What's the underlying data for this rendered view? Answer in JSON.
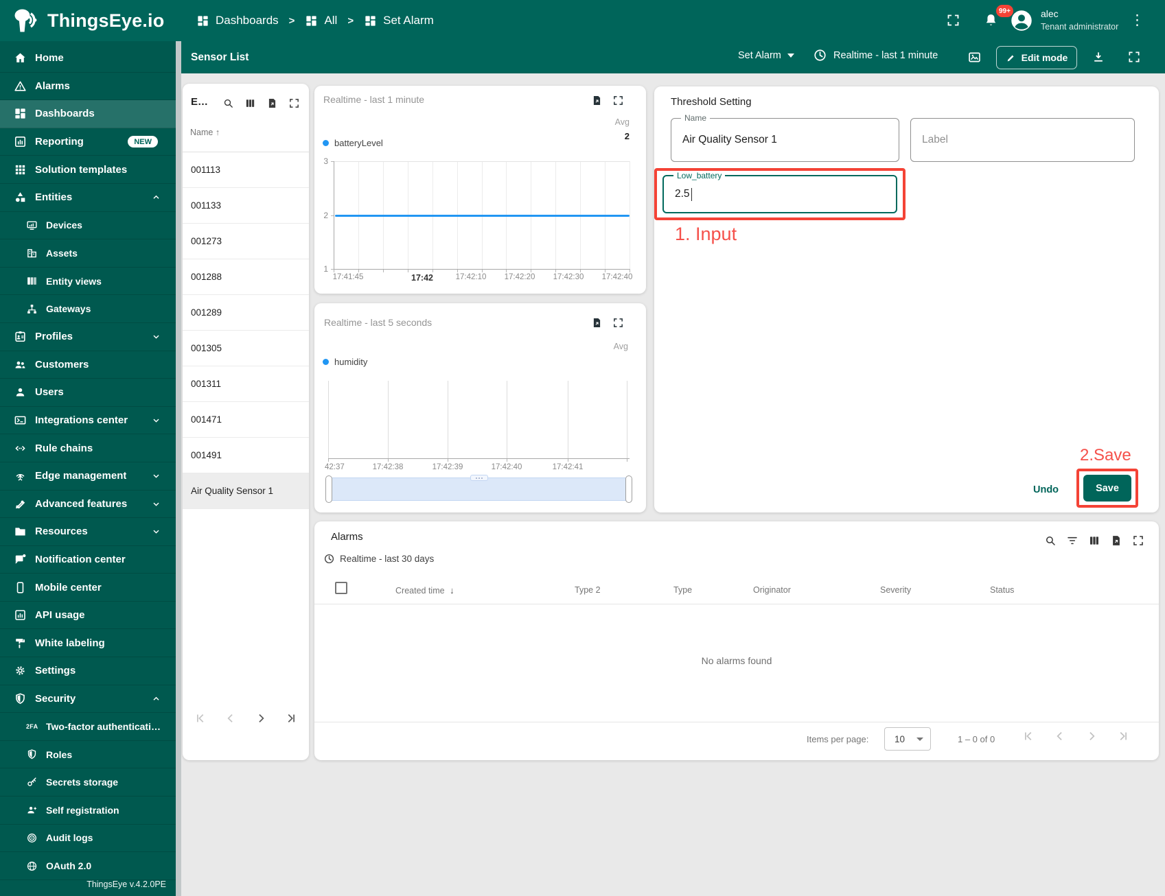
{
  "app": {
    "brand": "ThingsEye.io",
    "version_footer": "ThingsEye v.4.2.0PE"
  },
  "colors": {
    "header_green": "#00655a",
    "sidebar_green": "#00594f",
    "accent_teal": "#00695c",
    "annotation_red": "#f44336",
    "chart_blue": "#2196f3",
    "badge_red": "#f44336",
    "selected_row_bg": "#ededed"
  },
  "header": {
    "breadcrumbs": [
      {
        "label": "Dashboards",
        "icon": "dashboard-grid"
      },
      {
        "label": "All",
        "icon": "dashboard-grid"
      },
      {
        "label": "Set Alarm",
        "icon": "dashboard-grid"
      }
    ],
    "separator": ">",
    "right": {
      "fullscreen_icon": "fullscreen",
      "notifications_icon": "bell",
      "notification_badge": "99+",
      "user_name": "alec",
      "user_role": "Tenant administrator",
      "menu_icon": "kebab"
    }
  },
  "dashboard_toolbar": {
    "title": "Sensor List",
    "state_label": "Set Alarm",
    "time_window": "Realtime - last 1 minute",
    "image_icon": "image",
    "edit_button": {
      "label": "Edit mode",
      "icon": "pencil"
    },
    "download_icon": "download",
    "fullscreen_icon": "fullscreen"
  },
  "sidebar": {
    "items": [
      {
        "label": "Home",
        "icon": "home",
        "level": 0
      },
      {
        "label": "Alarms",
        "icon": "warning",
        "level": 0
      },
      {
        "label": "Dashboards",
        "icon": "dashboard-grid",
        "level": 0,
        "active": true
      },
      {
        "label": "Reporting",
        "icon": "report",
        "level": 0,
        "badge": "NEW"
      },
      {
        "label": "Solution templates",
        "icon": "apps",
        "level": 0
      },
      {
        "label": "Entities",
        "icon": "entities",
        "level": 0,
        "chevron": "up"
      },
      {
        "label": "Devices",
        "icon": "devices",
        "level": 1
      },
      {
        "label": "Assets",
        "icon": "assets",
        "level": 1
      },
      {
        "label": "Entity views",
        "icon": "entity-views",
        "level": 1
      },
      {
        "label": "Gateways",
        "icon": "gateways",
        "level": 1
      },
      {
        "label": "Profiles",
        "icon": "profiles",
        "level": 0,
        "chevron": "down"
      },
      {
        "label": "Customers",
        "icon": "customers",
        "level": 0
      },
      {
        "label": "Users",
        "icon": "users",
        "level": 0
      },
      {
        "label": "Integrations center",
        "icon": "integrations",
        "level": 0,
        "chevron": "down"
      },
      {
        "label": "Rule chains",
        "icon": "rule-chains",
        "level": 0
      },
      {
        "label": "Edge management",
        "icon": "edge",
        "level": 0,
        "chevron": "down"
      },
      {
        "label": "Advanced features",
        "icon": "advanced",
        "level": 0,
        "chevron": "down"
      },
      {
        "label": "Resources",
        "icon": "resources",
        "level": 0,
        "chevron": "down"
      },
      {
        "label": "Notification center",
        "icon": "notification",
        "level": 0
      },
      {
        "label": "Mobile center",
        "icon": "mobile",
        "level": 0
      },
      {
        "label": "API usage",
        "icon": "api",
        "level": 0
      },
      {
        "label": "White labeling",
        "icon": "white-label",
        "level": 0
      },
      {
        "label": "Settings",
        "icon": "settings",
        "level": 0
      },
      {
        "label": "Security",
        "icon": "shield",
        "level": 0,
        "chevron": "up"
      },
      {
        "label": "Two-factor authenticati…",
        "icon": "2fa",
        "level": 1
      },
      {
        "label": "Roles",
        "icon": "shield",
        "level": 1
      },
      {
        "label": "Secrets storage",
        "icon": "key",
        "level": 1
      },
      {
        "label": "Self registration",
        "icon": "person-add",
        "level": 1
      },
      {
        "label": "Audit logs",
        "icon": "audit",
        "level": 1
      },
      {
        "label": "OAuth 2.0",
        "icon": "oauth",
        "level": 1
      }
    ]
  },
  "entity_table": {
    "title": "E…",
    "header_icons": [
      "search",
      "columns",
      "file-export",
      "fullscreen"
    ],
    "name_column": "Name",
    "sort_direction": "asc",
    "sort_arrow": "↑",
    "rows": [
      "001113",
      "001133",
      "001273",
      "001288",
      "001289",
      "001305",
      "001311",
      "001471",
      "001491",
      "Air Quality Sensor 1"
    ],
    "selected_row_index": 9,
    "pagination_icons": [
      "first-page",
      "chevron-left",
      "chevron-right",
      "last-page"
    ]
  },
  "chart_data": [
    {
      "type": "line",
      "title": "Realtime - last 1 minute",
      "series": [
        {
          "name": "batteryLevel",
          "color": "#2196f3",
          "values": [
            2,
            2,
            2,
            2,
            2,
            2
          ],
          "avg": 2
        }
      ],
      "x": [
        "17:41:45",
        "17:42",
        "17:42:10",
        "17:42:20",
        "17:42:30",
        "17:42:40"
      ],
      "bold_x_index": 1,
      "yticks": [
        3,
        2,
        1
      ],
      "ylim": [
        1,
        3
      ],
      "summary_column": {
        "label": "Avg",
        "values": [
          "2"
        ]
      },
      "legend_position": "top-left",
      "grid": true,
      "header_icons": [
        "file-export",
        "fullscreen"
      ]
    },
    {
      "type": "line",
      "title": "Realtime - last 5 seconds",
      "series": [
        {
          "name": "humidity",
          "color": "#2196f3",
          "values": [],
          "avg": null
        }
      ],
      "x": [
        "42:37",
        "17:42:38",
        "17:42:39",
        "17:42:40",
        "17:42:41"
      ],
      "yticks": [],
      "summary_column": {
        "label": "Avg",
        "values": []
      },
      "legend_position": "top-left",
      "grid": true,
      "has_datazoom_slider": true,
      "header_icons": [
        "file-export",
        "fullscreen"
      ]
    }
  ],
  "threshold_panel": {
    "title": "Threshold Setting",
    "name_field": {
      "label": "Name",
      "value": "Air Quality Sensor 1"
    },
    "label_field": {
      "placeholder": "Label"
    },
    "threshold_field": {
      "label": "Low_battery",
      "value": "2.5",
      "focused": true
    },
    "undo_label": "Undo",
    "save_label": "Save"
  },
  "annotations": {
    "step1_label": "1. Input",
    "step2_label": "2.Save"
  },
  "alarms_panel": {
    "title": "Alarms",
    "time_window": "Realtime - last 30 days",
    "header_icons": [
      "search",
      "filter",
      "columns",
      "file-export",
      "fullscreen"
    ],
    "columns": [
      "Created time",
      "Type 2",
      "Type",
      "Originator",
      "Severity",
      "Status"
    ],
    "sorted_column": "Created time",
    "sort_direction": "desc",
    "sort_arrow": "↓",
    "empty_text": "No alarms found",
    "paginator": {
      "items_per_page_label": "Items per page:",
      "items_per_page": "10",
      "range_label": "1 – 0 of 0",
      "nav_icons": [
        "first-page",
        "chevron-left",
        "chevron-right",
        "last-page"
      ]
    }
  }
}
